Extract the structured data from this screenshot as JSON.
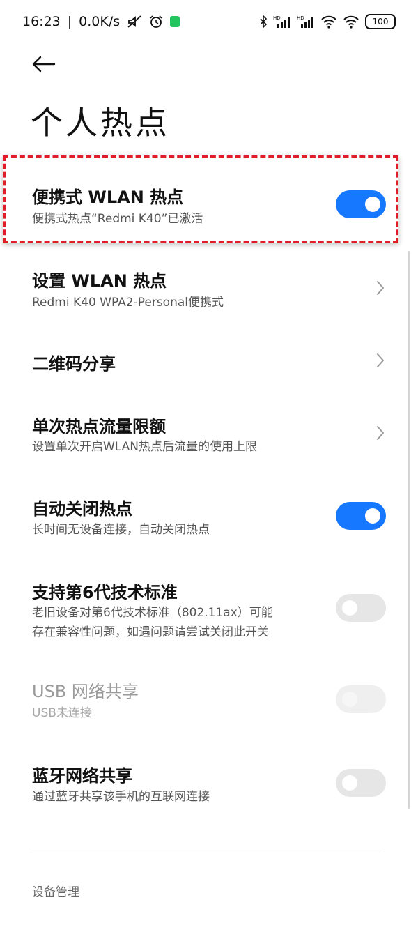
{
  "status_bar": {
    "time": "16:23",
    "network_speed": "0.0K/s",
    "battery": "100",
    "icons": [
      "mute-icon",
      "alarm-icon",
      "app-notification-icon",
      "bluetooth-icon",
      "signal-hd-icon",
      "signal-hd-icon",
      "wifi-icon",
      "wifi-hotspot-icon",
      "battery-icon"
    ]
  },
  "header": {
    "back_icon": "arrow-left-icon",
    "title": "个人热点"
  },
  "settings": [
    {
      "id": "portable-wlan-hotspot",
      "title": "便携式 WLAN 热点",
      "subtitle": "便携式热点“Redmi K40”已激活",
      "control": "toggle",
      "state": "on",
      "highlighted": true
    },
    {
      "id": "setup-wlan-hotspot",
      "title": "设置 WLAN 热点",
      "subtitle": "Redmi K40 WPA2-Personal便携式",
      "control": "chevron"
    },
    {
      "id": "qr-share",
      "title": "二维码分享",
      "subtitle": "",
      "control": "chevron"
    },
    {
      "id": "single-hotspot-limit",
      "title": "单次热点流量限额",
      "subtitle": "设置单次开启WLAN热点后流量的使用上限",
      "control": "chevron"
    },
    {
      "id": "auto-close-hotspot",
      "title": "自动关闭热点",
      "subtitle": "长时间无设备连接，自动关闭热点",
      "control": "toggle",
      "state": "on"
    },
    {
      "id": "support-wifi6",
      "title": "支持第6代技术标准",
      "subtitle_lines": [
        "老旧设备对第6代技术标准（802.11ax）可能",
        "存在兼容性问题，如遇问题请尝试关闭此开关"
      ],
      "control": "toggle",
      "state": "off"
    },
    {
      "id": "usb-tethering",
      "title": "USB 网络共享",
      "subtitle": "USB未连接",
      "control": "toggle",
      "state": "disabled"
    },
    {
      "id": "bluetooth-tethering",
      "title": "蓝牙网络共享",
      "subtitle": "通过蓝牙共享该手机的互联网连接",
      "control": "toggle",
      "state": "off"
    }
  ],
  "footer": {
    "section_label": "设备管理"
  },
  "colors": {
    "toggle_on": "#1677ff",
    "toggle_off": "#e6e6e6",
    "highlight_border": "#e11d2b"
  }
}
